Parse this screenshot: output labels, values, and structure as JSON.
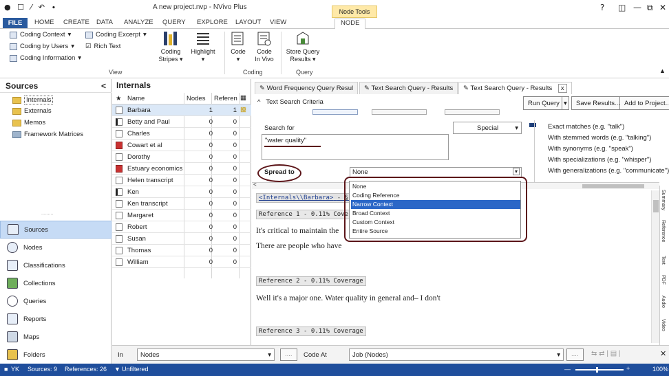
{
  "window": {
    "title": "A new project.nvp - NVivo Plus",
    "context_tab": "Node Tools",
    "help": "?",
    "min": "—",
    "restore": "͸",
    "close": "✕"
  },
  "ribbon_tabs": [
    "FILE",
    "HOME",
    "CREATE",
    "DATA",
    "ANALYZE",
    "QUERY",
    "EXPLORE",
    "LAYOUT",
    "VIEW",
    "NODE"
  ],
  "ribbon": {
    "view_items": [
      "Coding Context",
      "Coding by Users",
      "Coding Information"
    ],
    "view_items2": [
      "Coding Excerpt",
      "Rich Text"
    ],
    "coding_stripes": "Coding\nStripes",
    "highlight": "Highlight",
    "code": "Code",
    "code_in_vivo": "Code\nIn Vivo",
    "store_query": "Store Query\nResults",
    "groups": [
      "View",
      "Coding",
      "Query"
    ]
  },
  "sources": {
    "header": "Sources",
    "items": [
      "Internals",
      "Externals",
      "Memos",
      "Framework Matrices"
    ],
    "chevron": "<"
  },
  "nav": [
    "Sources",
    "Nodes",
    "Classifications",
    "Collections",
    "Queries",
    "Reports",
    "Maps",
    "Folders"
  ],
  "internals": {
    "header": "Internals",
    "columns": [
      "Name",
      "Nodes",
      "Referen"
    ],
    "rows": [
      {
        "name": "Barbara",
        "nodes": "1",
        "refs": "1"
      },
      {
        "name": "Betty and Paul",
        "nodes": "0",
        "refs": "0"
      },
      {
        "name": "Charles",
        "nodes": "0",
        "refs": "0"
      },
      {
        "name": "Cowart et al",
        "nodes": "0",
        "refs": "0"
      },
      {
        "name": "Dorothy",
        "nodes": "0",
        "refs": "0"
      },
      {
        "name": "Estuary economics",
        "nodes": "0",
        "refs": "0"
      },
      {
        "name": "Helen transcript",
        "nodes": "0",
        "refs": "0"
      },
      {
        "name": "Ken",
        "nodes": "0",
        "refs": "0"
      },
      {
        "name": "Ken transcript",
        "nodes": "0",
        "refs": "0"
      },
      {
        "name": "Margaret",
        "nodes": "0",
        "refs": "0"
      },
      {
        "name": "Robert",
        "nodes": "0",
        "refs": "0"
      },
      {
        "name": "Susan",
        "nodes": "0",
        "refs": "0"
      },
      {
        "name": "Thomas",
        "nodes": "0",
        "refs": "0"
      },
      {
        "name": "William",
        "nodes": "0",
        "refs": "0"
      }
    ]
  },
  "query_tabs": [
    "Word Frequency Query Resul",
    "Text Search Query - Results",
    "Text Search Query - Results"
  ],
  "query_tab_close": "x",
  "criteria": {
    "title": "Text Search Criteria",
    "run_query": "Run Query",
    "save_results": "Save Results...",
    "add_to_project": "Add to Project...",
    "search_for_label": "Search for",
    "search_for_value": "\"water quality\"",
    "special": "Special",
    "spread_to_label": "Spread to",
    "spread_to_value": "None",
    "options": [
      "Exact matches (e.g. \"talk\")",
      "With stemmed words (e.g. \"talking\")",
      "With synonyms (e.g. \"speak\")",
      "With specializations (e.g. \"whisper\")",
      "With generalizations (e.g. \"communicate\")"
    ]
  },
  "spread_options": [
    "None",
    "Coding Reference",
    "Narrow Context",
    "Broad Context",
    "Custom Context",
    "Entire Source"
  ],
  "results": {
    "source_link": "<Internals\\\\Barbara>",
    "source_suffix": "- § 8 re",
    "ref1": "Reference 1 - 0.11% Coverage",
    "text1": "It's critical to maintain the",
    "text2": "There are people who have",
    "ref2": "Reference 2 - 0.11% Coverage",
    "text3": "Well it's a major one. Water quality in general and– I don't",
    "ref3": "Reference 3 - 0.11% Coverage"
  },
  "side_tabs": [
    "Summary",
    "Reference",
    "Text",
    "PDF",
    "Audio",
    "Video"
  ],
  "bottom_bar": {
    "in_label": "In",
    "in_value": "Nodes",
    "code_at_label": "Code At",
    "code_at_value": "Job (Nodes)"
  },
  "status": {
    "user": "YK",
    "sources": "Sources: 9",
    "references": "References: 26",
    "filter": "Unfiltered",
    "zoom": "100%"
  }
}
